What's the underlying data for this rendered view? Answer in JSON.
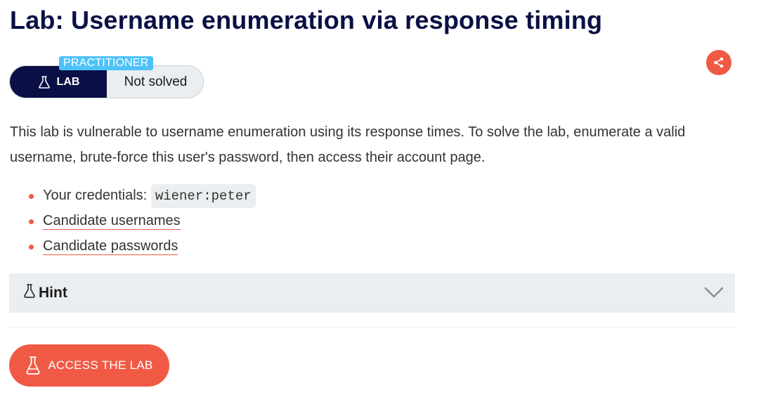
{
  "page": {
    "title": "Lab: Username enumeration via response timing"
  },
  "status": {
    "level": "PRACTITIONER",
    "lab_label": "LAB",
    "solved_text": "Not solved"
  },
  "description": "This lab is vulnerable to username enumeration using its response times. To solve the lab, enumerate a valid username, brute-force this user's password, then access their account page.",
  "resources": {
    "credentials_label": "Your credentials:",
    "credentials_value": "wiener:peter",
    "usernames_link": "Candidate usernames",
    "passwords_link": "Candidate passwords"
  },
  "hint": {
    "label": "Hint"
  },
  "cta": {
    "label": "ACCESS THE LAB"
  },
  "colors": {
    "navy": "#0a1045",
    "accent": "#f05a45",
    "practitioner": "#4ec2f7",
    "panel": "#ebeef0"
  },
  "icons": {
    "share": "share-icon",
    "flask": "flask-icon",
    "chevron": "chevron-down-icon"
  }
}
